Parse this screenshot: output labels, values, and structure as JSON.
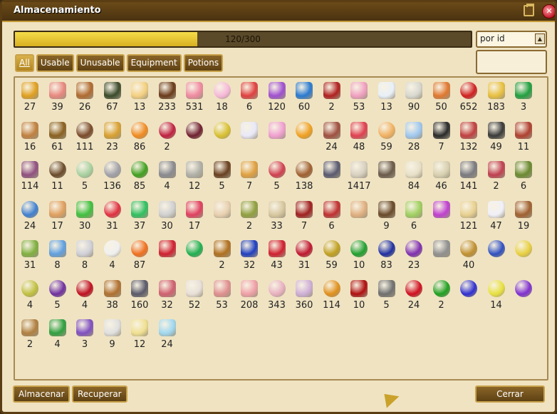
{
  "window": {
    "title": "Almacenamiento",
    "minimize_icon": "minimize-icon",
    "close_icon": "close-icon"
  },
  "capacity": {
    "text": "120/300",
    "used": 120,
    "max": 300,
    "fill_color": "#f0d040"
  },
  "sort": {
    "selected": "por id",
    "icon": "arrow-up-icon"
  },
  "tabs": [
    {
      "label": "All",
      "active": true
    },
    {
      "label": "Usable",
      "active": false
    },
    {
      "label": "Unusable",
      "active": false
    },
    {
      "label": "Equipment",
      "active": false
    },
    {
      "label": "Potions",
      "active": false
    }
  ],
  "buttons": {
    "store": "Almacenar",
    "retrieve": "Recuperar",
    "close": "Cerrar"
  },
  "items": [
    {
      "name": "coin-pile",
      "q": "27",
      "c": "#e0a020"
    },
    {
      "name": "pink-stick",
      "q": "39",
      "c": "#e88880"
    },
    {
      "name": "brown-stick",
      "q": "26",
      "c": "#b06a30"
    },
    {
      "name": "dark-feather",
      "q": "67",
      "c": "#3a4a2a"
    },
    {
      "name": "cake-slice",
      "q": "13",
      "c": "#f4d080"
    },
    {
      "name": "chocolate-bar",
      "q": "233",
      "c": "#6a3a1a"
    },
    {
      "name": "pink-candy",
      "q": "531",
      "c": "#f08aa0"
    },
    {
      "name": "pink-egg",
      "q": "18",
      "c": "#f6b8d8"
    },
    {
      "name": "candy-cane",
      "q": "6",
      "c": "#e04040"
    },
    {
      "name": "purple-gift",
      "q": "120",
      "c": "#a050d0"
    },
    {
      "name": "blue-gift",
      "q": "60",
      "c": "#2a7ad0"
    },
    {
      "name": "red-feather",
      "q": "2",
      "c": "#b02020"
    },
    {
      "name": "pink-gem",
      "q": "53",
      "c": "#f0a0c0"
    },
    {
      "name": "milk-carton",
      "q": "13",
      "c": "#e8f0f8"
    },
    {
      "name": "white-shell",
      "q": "90",
      "c": "#d8d8d0"
    },
    {
      "name": "cupcake",
      "q": "50",
      "c": "#e07830"
    },
    {
      "name": "red-apple",
      "q": "652",
      "c": "#d02020"
    },
    {
      "name": "gold-key",
      "q": "183",
      "c": "#e8c040"
    },
    {
      "name": "green-gift",
      "q": "3",
      "c": "#20a040"
    },
    {
      "name": "drumstick",
      "q": "16",
      "c": "#c08040"
    },
    {
      "name": "necklace",
      "q": "61",
      "c": "#8a6020"
    },
    {
      "name": "brown-cookie",
      "q": "111",
      "c": "#7a4a2a"
    },
    {
      "name": "gold-zigzag",
      "q": "23",
      "c": "#d8a030"
    },
    {
      "name": "orange-fruit",
      "q": "86",
      "c": "#f08a20"
    },
    {
      "name": "red-berry-leaf",
      "q": "2",
      "c": "#c02040"
    },
    {
      "name": "dark-berry-leaf",
      "q": "",
      "c": "#702030"
    },
    {
      "name": "yellow-berry-leaf",
      "q": "",
      "c": "#d8c030"
    },
    {
      "name": "white-tulip",
      "q": "",
      "c": "#e8e8f8"
    },
    {
      "name": "pink-tulip",
      "q": "",
      "c": "#f0a0d0"
    },
    {
      "name": "orange-tulip",
      "q": "",
      "c": "#f0a020"
    },
    {
      "name": "steak",
      "q": "24",
      "c": "#a05040"
    },
    {
      "name": "red-vial",
      "q": "48",
      "c": "#e04050"
    },
    {
      "name": "orange-vial",
      "q": "59",
      "c": "#f0b060"
    },
    {
      "name": "blue-vial",
      "q": "28",
      "c": "#a0c8f0"
    },
    {
      "name": "black-feather",
      "q": "7",
      "c": "#2a2a2a"
    },
    {
      "name": "red-worm",
      "q": "132",
      "c": "#c04040"
    },
    {
      "name": "black-worm",
      "q": "49",
      "c": "#3a3a3a"
    },
    {
      "name": "red-claw",
      "q": "11",
      "c": "#b04030"
    },
    {
      "name": "purple-worm",
      "q": "114",
      "c": "#905080"
    },
    {
      "name": "brown-egg",
      "q": "11",
      "c": "#6a4a2a"
    },
    {
      "name": "green-egg",
      "q": "5",
      "c": "#a8d0a0"
    },
    {
      "name": "grey-egg",
      "q": "136",
      "c": "#a0a0a8"
    },
    {
      "name": "green-apple",
      "q": "85",
      "c": "#40a020"
    },
    {
      "name": "grey-cube",
      "q": "4",
      "c": "#8a8a90"
    },
    {
      "name": "silver-cake",
      "q": "12",
      "c": "#b0b0a8"
    },
    {
      "name": "chocolate-cake",
      "q": "5",
      "c": "#6a4020"
    },
    {
      "name": "cream-cake",
      "q": "7",
      "c": "#e0a040"
    },
    {
      "name": "strawberry-cake",
      "q": "5",
      "c": "#d04050"
    },
    {
      "name": "acorn",
      "q": "138",
      "c": "#a06030"
    },
    {
      "name": "bat-wing",
      "q": "",
      "c": "#5a5a70"
    },
    {
      "name": "fang",
      "q": "1417",
      "c": "#d8d0c0"
    },
    {
      "name": "rock-pile",
      "q": "",
      "c": "#6a5a4a"
    },
    {
      "name": "bone",
      "q": "84",
      "c": "#e8e0c8"
    },
    {
      "name": "skull",
      "q": "46",
      "c": "#d8d0b0"
    },
    {
      "name": "grey-rope",
      "q": "141",
      "c": "#7a7a80"
    },
    {
      "name": "heart-organ",
      "q": "2",
      "c": "#c04050"
    },
    {
      "name": "green-leaf",
      "q": "6",
      "c": "#6a8a30"
    },
    {
      "name": "blue-orb",
      "q": "24",
      "c": "#4080d0"
    },
    {
      "name": "sandwich",
      "q": "17",
      "c": "#e0a060"
    },
    {
      "name": "green-slime",
      "q": "30",
      "c": "#40c040"
    },
    {
      "name": "strawberry",
      "q": "31",
      "c": "#e03040"
    },
    {
      "name": "green-potion-cup",
      "q": "37",
      "c": "#30c060"
    },
    {
      "name": "skull-mug",
      "q": "30",
      "c": "#d0d0d0"
    },
    {
      "name": "cocktail",
      "q": "17",
      "c": "#e04060"
    },
    {
      "name": "bubble-jar",
      "q": "",
      "c": "#e8d0b0"
    },
    {
      "name": "green-bundle",
      "q": "2",
      "c": "#90a040"
    },
    {
      "name": "paper-scroll",
      "q": "33",
      "c": "#d8c8a0"
    },
    {
      "name": "red-cloth",
      "q": "7",
      "c": "#a02020"
    },
    {
      "name": "red-scarf",
      "q": "6",
      "c": "#c03030"
    },
    {
      "name": "voodoo-doll",
      "q": "",
      "c": "#e0b080"
    },
    {
      "name": "horn",
      "q": "9",
      "c": "#6a4a2a"
    },
    {
      "name": "green-lily",
      "q": "6",
      "c": "#a0d060"
    },
    {
      "name": "purple-lollipop",
      "q": "",
      "c": "#c040d0"
    },
    {
      "name": "ice-cone",
      "q": "121",
      "c": "#e8d090"
    },
    {
      "name": "white-fur",
      "q": "47",
      "c": "#f0f0f8"
    },
    {
      "name": "brown-dog",
      "q": "19",
      "c": "#a06030"
    },
    {
      "name": "green-squid",
      "q": "31",
      "c": "#80b040"
    },
    {
      "name": "blue-jar",
      "q": "8",
      "c": "#60a0e0"
    },
    {
      "name": "magnifier",
      "q": "8",
      "c": "#d0d0d8"
    },
    {
      "name": "white-egg",
      "q": "4",
      "c": "#f0f0f0"
    },
    {
      "name": "orange-blast",
      "q": "87",
      "c": "#f07020"
    },
    {
      "name": "red-sock",
      "q": "",
      "c": "#d02030"
    },
    {
      "name": "green-easter-egg",
      "q": "",
      "c": "#20b050"
    },
    {
      "name": "torch",
      "q": "2",
      "c": "#b07020"
    },
    {
      "name": "blue-lollipop",
      "q": "32",
      "c": "#2040c0"
    },
    {
      "name": "red-lollipop",
      "q": "43",
      "c": "#d02030"
    },
    {
      "name": "red-ornament",
      "q": "31",
      "c": "#c01830"
    },
    {
      "name": "gold-ornament",
      "q": "59",
      "c": "#c0a020"
    },
    {
      "name": "green-ornament",
      "q": "10",
      "c": "#20a030"
    },
    {
      "name": "blue-ornament",
      "q": "83",
      "c": "#2030a0"
    },
    {
      "name": "purple-ornament",
      "q": "23",
      "c": "#8030b0"
    },
    {
      "name": "grey-chevron",
      "q": "",
      "c": "#909090"
    },
    {
      "name": "gold-easter-egg",
      "q": "40",
      "c": "#c09030"
    },
    {
      "name": "blue-berries",
      "q": "",
      "c": "#3050c0"
    },
    {
      "name": "yellow-disc",
      "q": "",
      "c": "#e8d040"
    },
    {
      "name": "pear",
      "q": "4",
      "c": "#c0c040"
    },
    {
      "name": "plum",
      "q": "5",
      "c": "#7030a0"
    },
    {
      "name": "cherries",
      "q": "4",
      "c": "#c01020"
    },
    {
      "name": "tiki-mask",
      "q": "38",
      "c": "#b07030"
    },
    {
      "name": "bat",
      "q": "160",
      "c": "#5a5a6a"
    },
    {
      "name": "brain",
      "q": "32",
      "c": "#d06070"
    },
    {
      "name": "eye-jar",
      "q": "52",
      "c": "#e8e0d8"
    },
    {
      "name": "pink-tongue",
      "q": "53",
      "c": "#e09090"
    },
    {
      "name": "pink-block",
      "q": "208",
      "c": "#f0a0a8"
    },
    {
      "name": "pink-pebble",
      "q": "343",
      "c": "#e8b0c0"
    },
    {
      "name": "lavender-bulb",
      "q": "360",
      "c": "#d0b0d8"
    },
    {
      "name": "pumpkin",
      "q": "114",
      "c": "#e0901c"
    },
    {
      "name": "red-horn",
      "q": "10",
      "c": "#b01010"
    },
    {
      "name": "grey-ore",
      "q": "5",
      "c": "#707070"
    },
    {
      "name": "red-orb",
      "q": "24",
      "c": "#d01020"
    },
    {
      "name": "green-orb",
      "q": "2",
      "c": "#20a020"
    },
    {
      "name": "blue-orb-dark",
      "q": "",
      "c": "#3030d0"
    },
    {
      "name": "yellow-orb",
      "q": "14",
      "c": "#e8e040"
    },
    {
      "name": "violet-orb",
      "q": "",
      "c": "#8030d0"
    },
    {
      "name": "straw-hat",
      "q": "2",
      "c": "#b08040"
    },
    {
      "name": "green-gift-box",
      "q": "4",
      "c": "#30a040"
    },
    {
      "name": "purple-gift-box",
      "q": "3",
      "c": "#8050c0"
    },
    {
      "name": "bone-pile",
      "q": "9",
      "c": "#e0e0e0"
    },
    {
      "name": "cheese-bar",
      "q": "12",
      "c": "#f0e090"
    },
    {
      "name": "ice-crystal",
      "q": "24",
      "c": "#a0d8f0"
    }
  ]
}
